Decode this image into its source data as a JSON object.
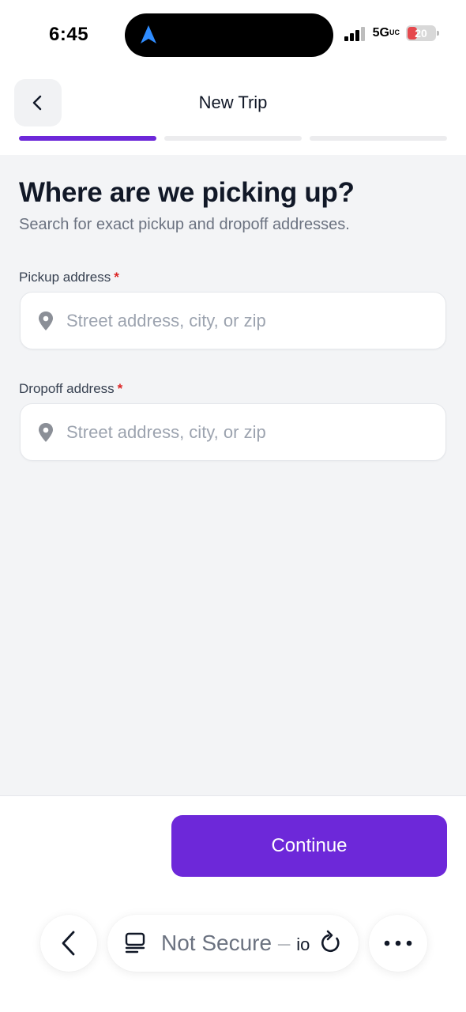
{
  "status_bar": {
    "time": "6:45",
    "network": "5G",
    "network_suffix": "UC",
    "battery": "20",
    "battery_color": "#e5484d"
  },
  "header": {
    "title": "New Trip",
    "back_icon": "chevron-left-icon"
  },
  "progress": {
    "total_steps": 3,
    "current_step": 1,
    "accent": "#6d28d9"
  },
  "main": {
    "title": "Where are we picking up?",
    "subtitle": "Search for exact pickup and dropoff addresses.",
    "pickup": {
      "label": "Pickup address",
      "required_mark": "*",
      "placeholder": "Street address, city, or zip",
      "value": ""
    },
    "dropoff": {
      "label": "Dropoff address",
      "required_mark": "*",
      "placeholder": "Street address, city, or zip",
      "value": ""
    }
  },
  "footer": {
    "continue_label": "Continue"
  },
  "browser": {
    "address_text": "Not Secure",
    "address_separator": " – ",
    "address_host_fragment": "io",
    "icons": [
      "chevron-left-icon",
      "tabs-icon",
      "reload-icon",
      "more-icon"
    ]
  }
}
